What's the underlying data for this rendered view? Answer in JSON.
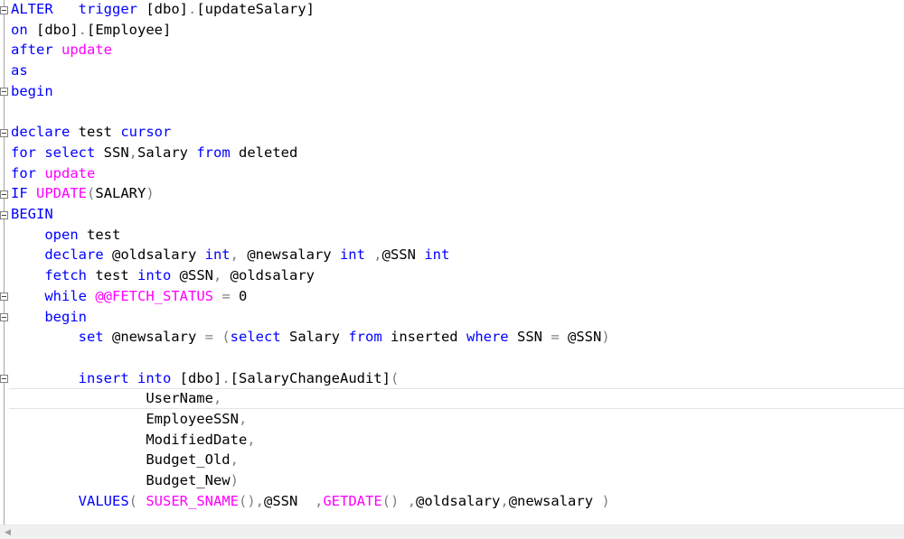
{
  "colors": {
    "keyword": "#0000ff",
    "function": "#ff00ff",
    "plain": "#000000",
    "operator": "#808080"
  },
  "icons": {
    "fold": "collapse-minus-icon",
    "scroll_left": "chevron-left-icon"
  },
  "code_lines": [
    {
      "tokens": [
        {
          "t": "ALTER",
          "c": "keyword"
        },
        {
          "t": "   ",
          "c": "plain"
        },
        {
          "t": "trigger",
          "c": "keyword"
        },
        {
          "t": " [dbo]",
          "c": "plain"
        },
        {
          "t": ".",
          "c": "operator"
        },
        {
          "t": "[updateSalary]",
          "c": "plain"
        }
      ],
      "fold": true
    },
    {
      "tokens": [
        {
          "t": "on",
          "c": "keyword"
        },
        {
          "t": " [dbo]",
          "c": "plain"
        },
        {
          "t": ".",
          "c": "operator"
        },
        {
          "t": "[Employee]",
          "c": "plain"
        }
      ]
    },
    {
      "tokens": [
        {
          "t": "after",
          "c": "keyword"
        },
        {
          "t": " ",
          "c": "plain"
        },
        {
          "t": "update",
          "c": "function"
        }
      ]
    },
    {
      "tokens": [
        {
          "t": "as",
          "c": "keyword"
        }
      ]
    },
    {
      "tokens": [
        {
          "t": "begin",
          "c": "keyword"
        }
      ],
      "fold": true
    },
    {
      "tokens": []
    },
    {
      "tokens": [
        {
          "t": "declare",
          "c": "keyword"
        },
        {
          "t": " test ",
          "c": "plain"
        },
        {
          "t": "cursor",
          "c": "keyword"
        }
      ],
      "fold": true
    },
    {
      "tokens": [
        {
          "t": "for",
          "c": "keyword"
        },
        {
          "t": " ",
          "c": "plain"
        },
        {
          "t": "select",
          "c": "keyword"
        },
        {
          "t": " SSN",
          "c": "plain"
        },
        {
          "t": ",",
          "c": "operator"
        },
        {
          "t": "Salary ",
          "c": "plain"
        },
        {
          "t": "from",
          "c": "keyword"
        },
        {
          "t": " deleted",
          "c": "plain"
        }
      ]
    },
    {
      "tokens": [
        {
          "t": "for",
          "c": "keyword"
        },
        {
          "t": " ",
          "c": "plain"
        },
        {
          "t": "update",
          "c": "function"
        }
      ]
    },
    {
      "tokens": [
        {
          "t": "IF",
          "c": "keyword"
        },
        {
          "t": " ",
          "c": "plain"
        },
        {
          "t": "UPDATE",
          "c": "function"
        },
        {
          "t": "(",
          "c": "operator"
        },
        {
          "t": "SALARY",
          "c": "plain"
        },
        {
          "t": ")",
          "c": "operator"
        }
      ],
      "fold": true
    },
    {
      "tokens": [
        {
          "t": "BEGIN",
          "c": "keyword"
        }
      ],
      "fold": true
    },
    {
      "tokens": [
        {
          "t": "    ",
          "c": "plain"
        },
        {
          "t": "open",
          "c": "keyword"
        },
        {
          "t": " test",
          "c": "plain"
        }
      ]
    },
    {
      "tokens": [
        {
          "t": "    ",
          "c": "plain"
        },
        {
          "t": "declare",
          "c": "keyword"
        },
        {
          "t": " @oldsalary ",
          "c": "plain"
        },
        {
          "t": "int",
          "c": "keyword"
        },
        {
          "t": ",",
          "c": "operator"
        },
        {
          "t": " @newsalary ",
          "c": "plain"
        },
        {
          "t": "int",
          "c": "keyword"
        },
        {
          "t": " ,",
          "c": "operator"
        },
        {
          "t": "@SSN ",
          "c": "plain"
        },
        {
          "t": "int",
          "c": "keyword"
        }
      ]
    },
    {
      "tokens": [
        {
          "t": "    ",
          "c": "plain"
        },
        {
          "t": "fetch",
          "c": "keyword"
        },
        {
          "t": " test ",
          "c": "plain"
        },
        {
          "t": "into",
          "c": "keyword"
        },
        {
          "t": " @SSN",
          "c": "plain"
        },
        {
          "t": ",",
          "c": "operator"
        },
        {
          "t": " @oldsalary",
          "c": "plain"
        }
      ]
    },
    {
      "tokens": [
        {
          "t": "    ",
          "c": "plain"
        },
        {
          "t": "while",
          "c": "keyword"
        },
        {
          "t": " ",
          "c": "plain"
        },
        {
          "t": "@@FETCH_STATUS",
          "c": "function"
        },
        {
          "t": " ",
          "c": "plain"
        },
        {
          "t": "=",
          "c": "operator"
        },
        {
          "t": " 0",
          "c": "plain"
        }
      ],
      "fold": true
    },
    {
      "tokens": [
        {
          "t": "    ",
          "c": "plain"
        },
        {
          "t": "begin",
          "c": "keyword"
        }
      ],
      "fold": true
    },
    {
      "tokens": [
        {
          "t": "        ",
          "c": "plain"
        },
        {
          "t": "set",
          "c": "keyword"
        },
        {
          "t": " @newsalary ",
          "c": "plain"
        },
        {
          "t": "=",
          "c": "operator"
        },
        {
          "t": " ",
          "c": "plain"
        },
        {
          "t": "(",
          "c": "operator"
        },
        {
          "t": "select",
          "c": "keyword"
        },
        {
          "t": " Salary ",
          "c": "plain"
        },
        {
          "t": "from",
          "c": "keyword"
        },
        {
          "t": " inserted ",
          "c": "plain"
        },
        {
          "t": "where",
          "c": "keyword"
        },
        {
          "t": " SSN ",
          "c": "plain"
        },
        {
          "t": "=",
          "c": "operator"
        },
        {
          "t": " @SSN",
          "c": "plain"
        },
        {
          "t": ")",
          "c": "operator"
        }
      ]
    },
    {
      "tokens": []
    },
    {
      "tokens": [
        {
          "t": "        ",
          "c": "plain"
        },
        {
          "t": "insert",
          "c": "keyword"
        },
        {
          "t": " ",
          "c": "plain"
        },
        {
          "t": "into",
          "c": "keyword"
        },
        {
          "t": " [dbo]",
          "c": "plain"
        },
        {
          "t": ".",
          "c": "operator"
        },
        {
          "t": "[SalaryChangeAudit]",
          "c": "plain"
        },
        {
          "t": "(",
          "c": "operator"
        }
      ],
      "fold": true
    },
    {
      "tokens": [
        {
          "t": "                ",
          "c": "plain"
        },
        {
          "t": "UserName",
          "c": "plain"
        },
        {
          "t": ",",
          "c": "operator"
        }
      ],
      "current": true
    },
    {
      "tokens": [
        {
          "t": "                ",
          "c": "plain"
        },
        {
          "t": "EmployeeSSN",
          "c": "plain"
        },
        {
          "t": ",",
          "c": "operator"
        }
      ]
    },
    {
      "tokens": [
        {
          "t": "                ",
          "c": "plain"
        },
        {
          "t": "ModifiedDate",
          "c": "plain"
        },
        {
          "t": ",",
          "c": "operator"
        }
      ]
    },
    {
      "tokens": [
        {
          "t": "                ",
          "c": "plain"
        },
        {
          "t": "Budget_Old",
          "c": "plain"
        },
        {
          "t": ",",
          "c": "operator"
        }
      ]
    },
    {
      "tokens": [
        {
          "t": "                ",
          "c": "plain"
        },
        {
          "t": "Budget_New",
          "c": "plain"
        },
        {
          "t": ")",
          "c": "operator"
        }
      ]
    },
    {
      "tokens": [
        {
          "t": "        ",
          "c": "plain"
        },
        {
          "t": "VALUES",
          "c": "keyword"
        },
        {
          "t": "(",
          "c": "operator"
        },
        {
          "t": " ",
          "c": "plain"
        },
        {
          "t": "SUSER_SNAME",
          "c": "function"
        },
        {
          "t": "(),",
          "c": "operator"
        },
        {
          "t": "@SSN  ",
          "c": "plain"
        },
        {
          "t": ",",
          "c": "operator"
        },
        {
          "t": "GETDATE",
          "c": "function"
        },
        {
          "t": "()",
          "c": "operator"
        },
        {
          "t": " ",
          "c": "plain"
        },
        {
          "t": ",",
          "c": "operator"
        },
        {
          "t": "@oldsalary",
          "c": "plain"
        },
        {
          "t": ",",
          "c": "operator"
        },
        {
          "t": "@newsalary ",
          "c": "plain"
        },
        {
          "t": ")",
          "c": "operator"
        }
      ]
    }
  ]
}
